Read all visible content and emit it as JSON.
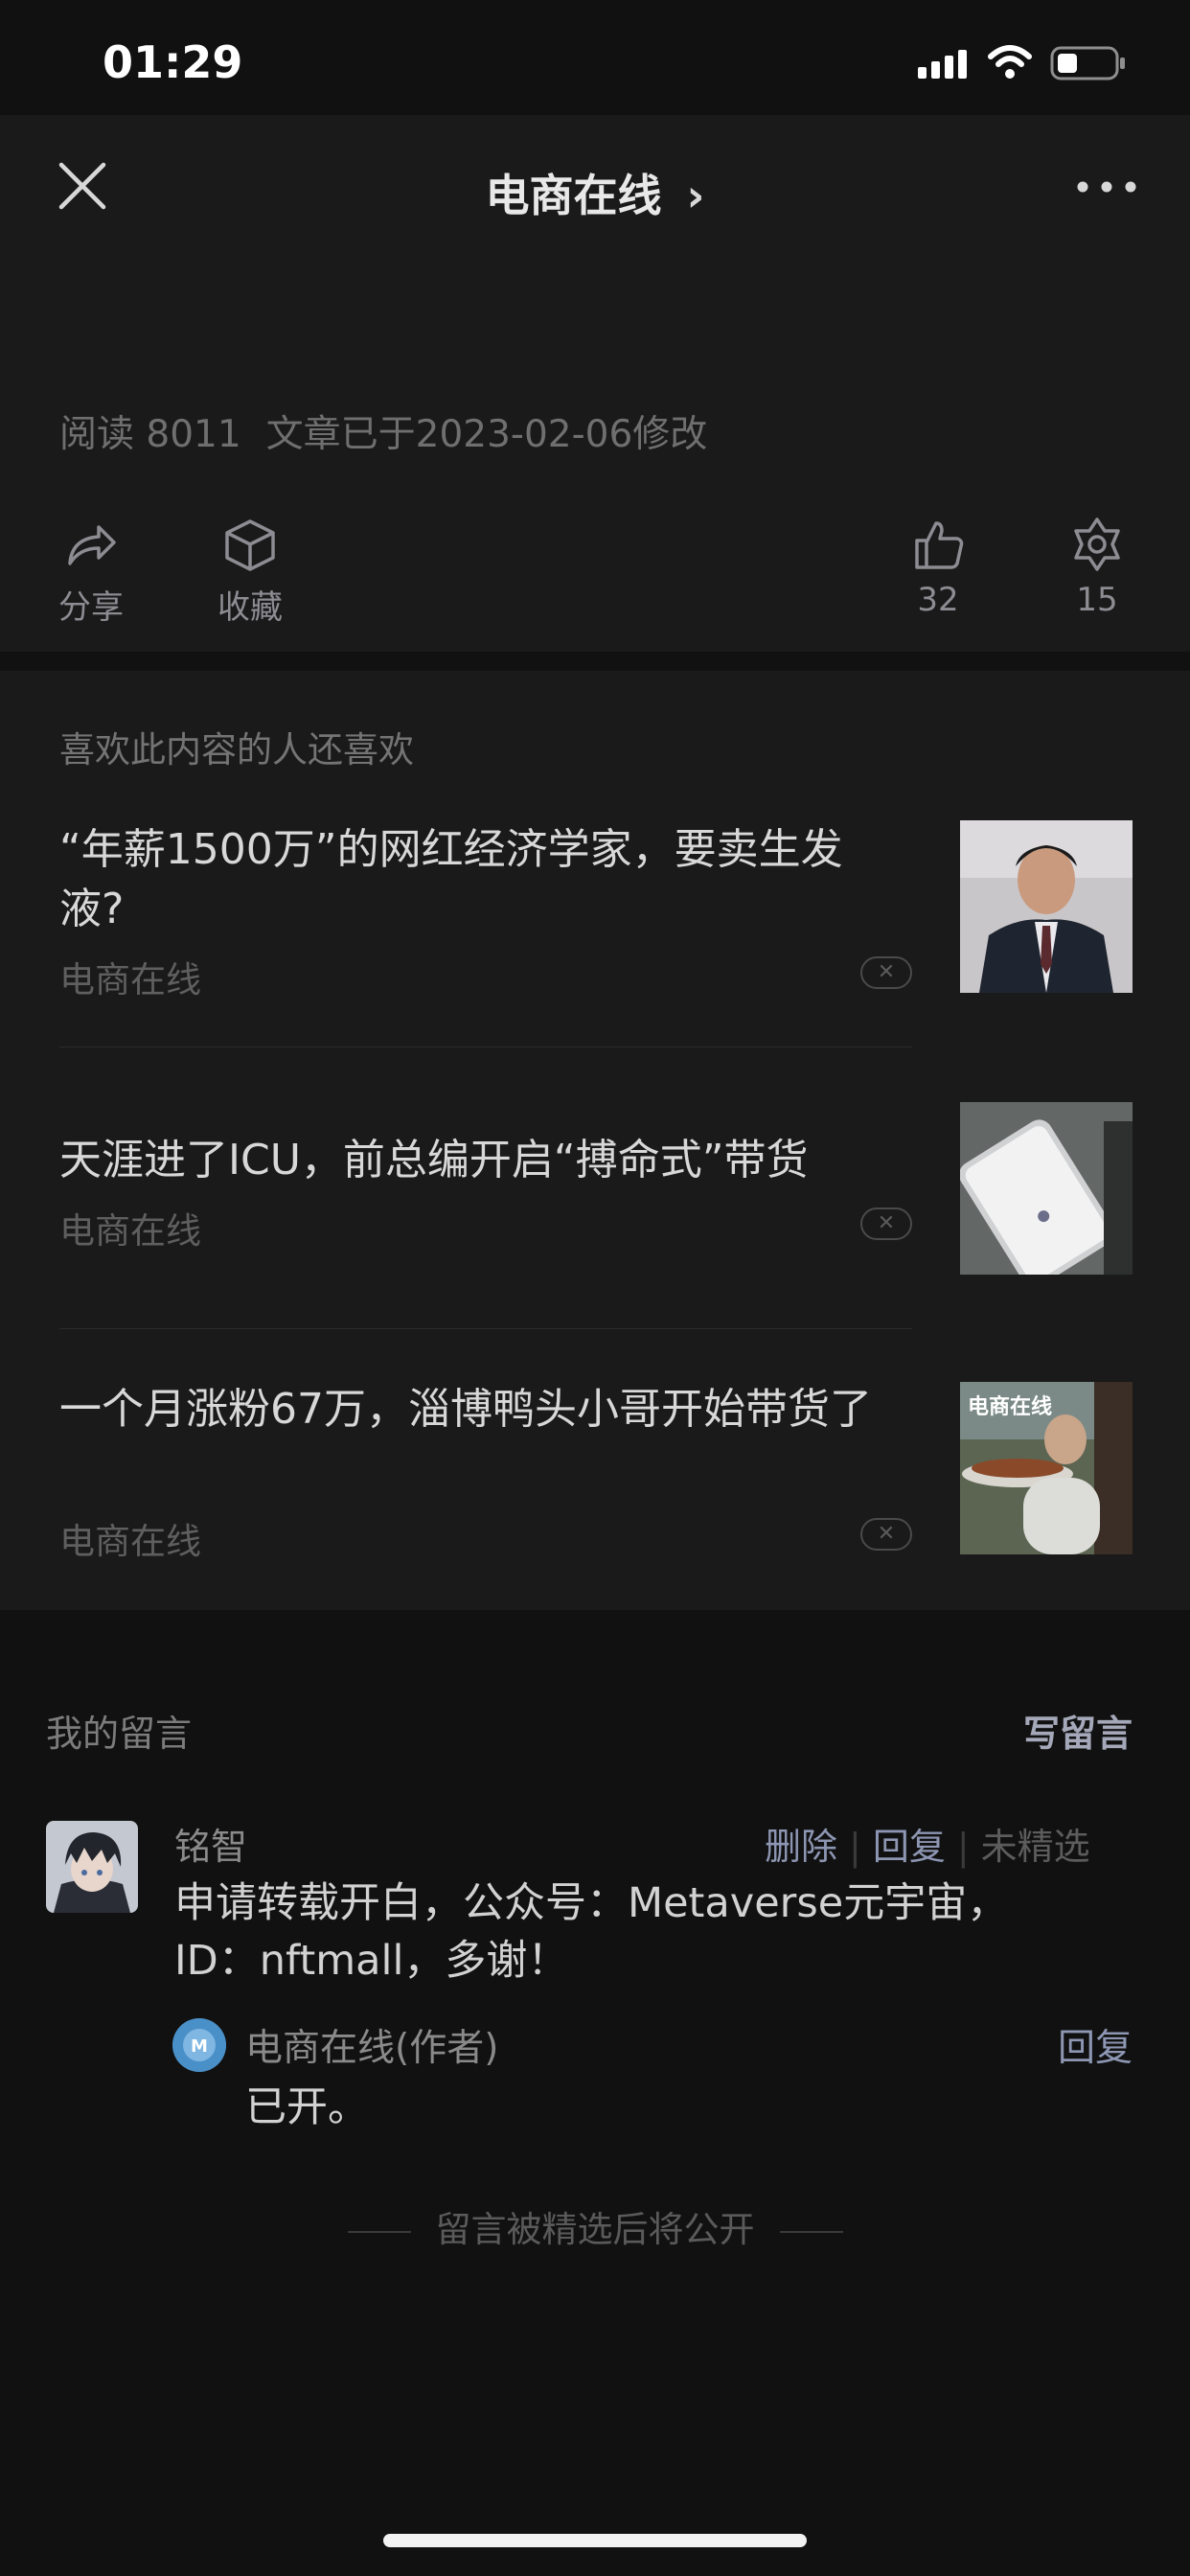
{
  "status_bar": {
    "time": "01:29"
  },
  "nav": {
    "title": "电商在线",
    "title_chevron": "›",
    "close_icon": "close-icon",
    "more_icon": "more-icon"
  },
  "article_meta": {
    "read_label": "阅读 8011",
    "modified_label": "文章已于2023-02-06修改"
  },
  "actions": {
    "share": {
      "icon": "share-icon",
      "label": "分享"
    },
    "collect": {
      "icon": "cube-icon",
      "label": "收藏"
    },
    "like": {
      "icon": "thumbs-up-icon",
      "count": "32"
    },
    "wow": {
      "icon": "flower-icon",
      "count": "15"
    }
  },
  "recommendations": {
    "heading": "喜欢此内容的人还喜欢",
    "items": [
      {
        "title": "“年薪1500万”的网红经济学家，要卖生发液?",
        "source": "电商在线",
        "thumb": "man-in-suit-photo"
      },
      {
        "title": "天涯进了ICU，前总编开启“搏命式”带货",
        "source": "电商在线",
        "thumb": "phone-photo"
      },
      {
        "title": "一个月涨粉67万，淄博鸭头小哥开始带货了",
        "source": "电商在线",
        "thumb": "food-vendor-photo",
        "thumb_caption": "电商在线"
      }
    ]
  },
  "comments": {
    "heading": "我的留言",
    "write_label": "写留言",
    "items": [
      {
        "name": "铭智",
        "delete_label": "删除",
        "reply_label": "回复",
        "status_label": "未精选",
        "text": "申请转载开白，公众号：Metaverse元宇宙，ID：nftmall，多谢！",
        "author_reply": {
          "name": "电商在线(作者)",
          "reply_label": "回复",
          "text": "已开。"
        }
      }
    ],
    "footer_note": "留言被精选后将公开"
  },
  "colors": {
    "background": "#111111",
    "card": "#1a1a1a",
    "link": "#8d96b2"
  }
}
